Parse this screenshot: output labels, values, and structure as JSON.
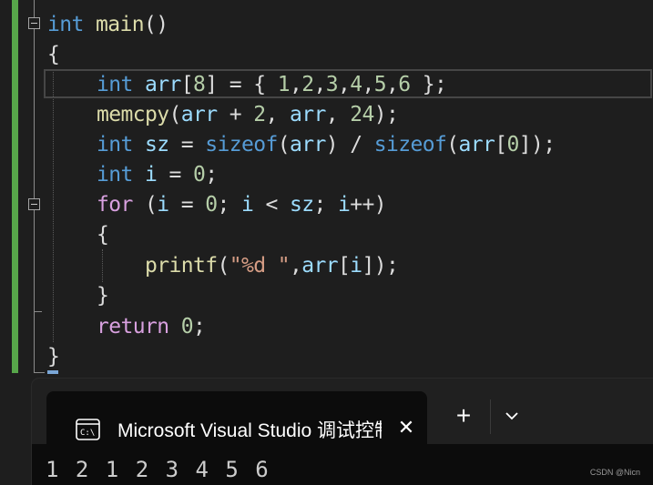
{
  "editor": {
    "lines": [
      {
        "tokens": [
          {
            "t": "int",
            "c": "kw"
          },
          {
            "t": " "
          },
          {
            "t": "main",
            "c": "fn"
          },
          {
            "t": "()"
          }
        ]
      },
      {
        "tokens": [
          {
            "t": "{"
          }
        ]
      },
      {
        "tokens": [
          {
            "t": "int",
            "c": "kw"
          },
          {
            "t": " "
          },
          {
            "t": "arr",
            "c": "var"
          },
          {
            "t": "["
          },
          {
            "t": "8",
            "c": "num"
          },
          {
            "t": "] = { "
          },
          {
            "t": "1",
            "c": "num"
          },
          {
            "t": ","
          },
          {
            "t": "2",
            "c": "num"
          },
          {
            "t": ","
          },
          {
            "t": "3",
            "c": "num"
          },
          {
            "t": ","
          },
          {
            "t": "4",
            "c": "num"
          },
          {
            "t": ","
          },
          {
            "t": "5",
            "c": "num"
          },
          {
            "t": ","
          },
          {
            "t": "6",
            "c": "num"
          },
          {
            "t": " };"
          }
        ]
      },
      {
        "tokens": [
          {
            "t": "memcpy",
            "c": "fn"
          },
          {
            "t": "("
          },
          {
            "t": "arr",
            "c": "var"
          },
          {
            "t": " + "
          },
          {
            "t": "2",
            "c": "num"
          },
          {
            "t": ", "
          },
          {
            "t": "arr",
            "c": "var"
          },
          {
            "t": ", "
          },
          {
            "t": "24",
            "c": "num"
          },
          {
            "t": ");"
          }
        ]
      },
      {
        "tokens": [
          {
            "t": "int",
            "c": "kw"
          },
          {
            "t": " "
          },
          {
            "t": "sz",
            "c": "var"
          },
          {
            "t": " = "
          },
          {
            "t": "sizeof",
            "c": "kw"
          },
          {
            "t": "("
          },
          {
            "t": "arr",
            "c": "var"
          },
          {
            "t": ") / "
          },
          {
            "t": "sizeof",
            "c": "kw"
          },
          {
            "t": "("
          },
          {
            "t": "arr",
            "c": "var"
          },
          {
            "t": "["
          },
          {
            "t": "0",
            "c": "num"
          },
          {
            "t": "]);"
          }
        ]
      },
      {
        "tokens": [
          {
            "t": "int",
            "c": "kw"
          },
          {
            "t": " "
          },
          {
            "t": "i",
            "c": "var"
          },
          {
            "t": " = "
          },
          {
            "t": "0",
            "c": "num"
          },
          {
            "t": ";"
          }
        ]
      },
      {
        "tokens": [
          {
            "t": "for",
            "c": "kw2"
          },
          {
            "t": " ("
          },
          {
            "t": "i",
            "c": "var"
          },
          {
            "t": " = "
          },
          {
            "t": "0",
            "c": "num"
          },
          {
            "t": "; "
          },
          {
            "t": "i",
            "c": "var"
          },
          {
            "t": " < "
          },
          {
            "t": "sz",
            "c": "var"
          },
          {
            "t": "; "
          },
          {
            "t": "i",
            "c": "var"
          },
          {
            "t": "++)"
          }
        ]
      },
      {
        "tokens": [
          {
            "t": "{"
          }
        ]
      },
      {
        "tokens": [
          {
            "t": "printf",
            "c": "fn"
          },
          {
            "t": "("
          },
          {
            "t": "\"%d \"",
            "c": "str"
          },
          {
            "t": ","
          },
          {
            "t": "arr",
            "c": "var"
          },
          {
            "t": "["
          },
          {
            "t": "i",
            "c": "var"
          },
          {
            "t": "]);"
          }
        ]
      },
      {
        "tokens": [
          {
            "t": "}"
          }
        ]
      },
      {
        "tokens": [
          {
            "t": "return",
            "c": "kw2"
          },
          {
            "t": " "
          },
          {
            "t": "0",
            "c": "num"
          },
          {
            "t": ";"
          }
        ]
      },
      {
        "tokens": [
          {
            "t": "}"
          }
        ]
      }
    ]
  },
  "terminal": {
    "tab_title": "Microsoft Visual Studio 调试控制台",
    "output": "1 2 1 2 3 4 5 6"
  },
  "watermark": "CSDN @Nicn",
  "icons": [
    "collapse-icon",
    "console-icon",
    "close-icon",
    "plus-icon",
    "chevron-down-icon"
  ],
  "colors": {
    "background": "#1e1e1e",
    "keyword": "#569cd6",
    "control_keyword": "#d8a0df",
    "function": "#dcdcaa",
    "variable": "#9cdcfe",
    "number": "#b5cea8",
    "string": "#d69d85",
    "change_bar": "#57a64a",
    "terminal": "#0c0c0c"
  }
}
